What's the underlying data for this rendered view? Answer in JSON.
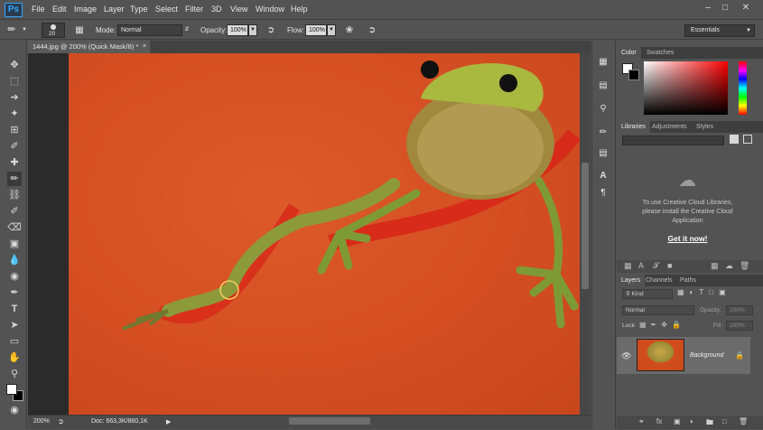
{
  "app": {
    "logo": "Ps",
    "menu": [
      "File",
      "Edit",
      "Image",
      "Layer",
      "Type",
      "Select",
      "Filter",
      "3D",
      "View",
      "Window",
      "Help"
    ],
    "window_buttons": [
      "minimize-icon",
      "restore-icon",
      "close-icon"
    ]
  },
  "options": {
    "brush_size": "20",
    "mode_label": "Mode:",
    "mode_value": "Normal",
    "opacity_label": "Opacity:",
    "opacity_value": "100%",
    "flow_label": "Flow:",
    "flow_value": "100%",
    "workspace": "Essentials"
  },
  "document": {
    "tab_title": "1444.jpg @ 200% (Quick Mask/8) *",
    "zoom": "200%",
    "doc_info": "Doc: 663,3K/860,1K"
  },
  "panels": {
    "color_tabs": [
      "Color",
      "Swatches"
    ],
    "libraries_tabs": [
      "Libraries",
      "Adjustments",
      "Styles"
    ],
    "cc_message_line1": "To use Creative Cloud Libraries,",
    "cc_message_line2": "please install the Creative Cloud",
    "cc_message_line3": "Application",
    "get_it_now": "Get it now!",
    "layers_tabs": [
      "Layers",
      "Channels",
      "Paths"
    ],
    "filter_kind": "Kind",
    "blend_mode": "Normal",
    "opacity_label": "Opacity:",
    "opacity_value": "100%",
    "lock_label": "Lock:",
    "fill_label": "Fill:",
    "fill_value": "100%",
    "layer_name": "Background"
  },
  "colors": {
    "accent": "#31a8ff",
    "canvas_bg": "#d4502a",
    "ui_bg": "#535353"
  }
}
